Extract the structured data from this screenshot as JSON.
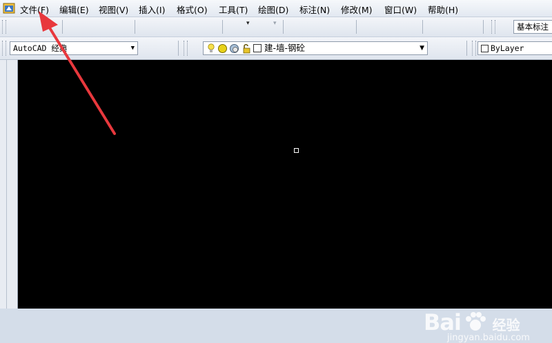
{
  "menubar": {
    "items": [
      {
        "label": "文件(F)"
      },
      {
        "label": "编辑(E)"
      },
      {
        "label": "视图(V)"
      },
      {
        "label": "插入(I)"
      },
      {
        "label": "格式(O)"
      },
      {
        "label": "工具(T)"
      },
      {
        "label": "绘图(D)"
      },
      {
        "label": "标注(N)"
      },
      {
        "label": "修改(M)"
      },
      {
        "label": "窗口(W)"
      },
      {
        "label": "帮助(H)"
      }
    ]
  },
  "toolbar1": {
    "style_combo": "基本标注"
  },
  "toolbar2": {
    "workspace_combo": "AutoCAD 经典",
    "layer_combo": "建-墙-钢砼",
    "color_combo": "ByLayer"
  },
  "watermark": {
    "logo": "Bai",
    "logo_suffix": "经验",
    "url": "jingyan.baidu.com"
  },
  "colors": {
    "canvas": "#000000",
    "annotation_arrow": "#e8383d",
    "toolbar_bg": "#e2e8f1"
  }
}
